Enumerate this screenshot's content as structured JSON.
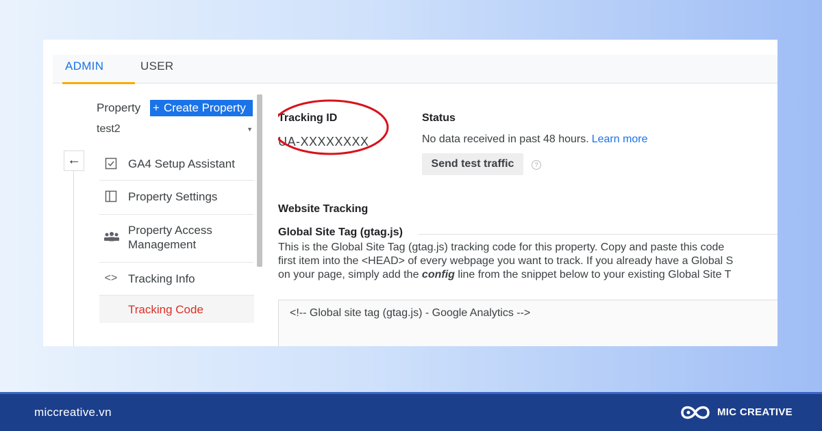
{
  "tabs": {
    "admin": "ADMIN",
    "user": "USER"
  },
  "property": {
    "label": "Property",
    "create_label": "Create Property",
    "selected": "test2"
  },
  "nav": [
    {
      "label": "GA4 Setup Assistant",
      "icon": "checkbox-icon"
    },
    {
      "label": "Property Settings",
      "icon": "window-icon"
    },
    {
      "label": "Property Access Management",
      "icon": "people-icon"
    },
    {
      "label": "Tracking Info",
      "icon": "code-brackets-icon"
    }
  ],
  "sub_nav": {
    "tracking_code": "Tracking Code"
  },
  "tracking": {
    "id_label": "Tracking ID",
    "id_value": "UA-XXXXXXXX"
  },
  "status": {
    "label": "Status",
    "text": "No data received in past 48 hours.",
    "link": "Learn more",
    "button": "Send test traffic"
  },
  "website_tracking": {
    "heading": "Website Tracking",
    "gst_heading": "Global Site Tag (gtag.js)",
    "desc_line1": "This is the Global Site Tag (gtag.js) tracking code for this property. Copy and paste this code",
    "desc_line2": "first item into the <HEAD> of every webpage you want to track. If you already have a Global S",
    "desc_line3_pre": "on your page, simply add the",
    "desc_line3_bold": "config",
    "desc_line3_post": "line from the snippet below to your existing Global Site T",
    "code_line1": "<!-- Global site tag (gtag.js) - Google Analytics -->"
  },
  "footer": {
    "url": "miccreative.vn",
    "brand": "MIC CREATIVE"
  },
  "colors": {
    "accent_blue": "#1a73e8",
    "tab_underline": "#f9ab00",
    "active_red": "#d93025",
    "highlight_circle": "#d8121b",
    "footer_bg": "#1c3f8b"
  }
}
